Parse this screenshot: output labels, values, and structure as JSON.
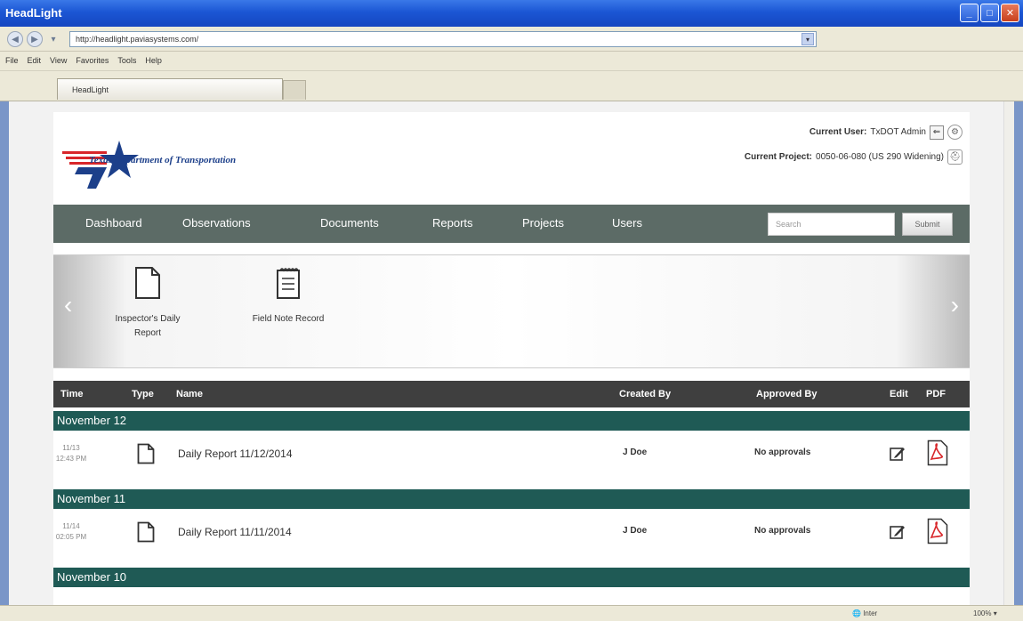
{
  "window": {
    "title": "HeadLight"
  },
  "browser": {
    "url": "http://headlight.paviasystems.com/",
    "menu": [
      "File",
      "Edit",
      "View",
      "Favorites",
      "Tools",
      "Help"
    ],
    "tab_title": "HeadLight",
    "status_zone": "Inter",
    "zoom": "100%"
  },
  "header": {
    "logo_text": "Texas Department of Transportation",
    "user_label": "Current User:",
    "user_value": "TxDOT Admin",
    "project_label": "Current Project:",
    "project_value": "0050-06-080 (US 290 Widening)"
  },
  "nav": {
    "items": [
      "Dashboard",
      "Observations",
      "Documents",
      "Reports",
      "Projects",
      "Users"
    ],
    "search_placeholder": "Search",
    "submit_label": "Submit"
  },
  "forms": [
    {
      "label": "Inspector's Daily Report",
      "icon": "document-icon"
    },
    {
      "label": "Field Note Record",
      "icon": "notepad-icon"
    }
  ],
  "table": {
    "headers": {
      "time": "Time",
      "type": "Type",
      "name": "Name",
      "created_by": "Created By",
      "approved_by": "Approved By",
      "edit": "Edit",
      "pdf": "PDF"
    },
    "groups": [
      {
        "date": "November 12",
        "rows": [
          {
            "time": "11/13 12:43 PM",
            "name": "Daily Report 11/12/2014",
            "created_by": "J Doe",
            "approved_by": "No approvals"
          }
        ]
      },
      {
        "date": "November 11",
        "rows": [
          {
            "time": "11/14 02:05 PM",
            "name": "Daily Report 11/11/2014",
            "created_by": "J Doe",
            "approved_by": "No approvals"
          }
        ]
      },
      {
        "date": "November 10",
        "rows": []
      }
    ]
  },
  "colors": {
    "navbar": "#5c6b66",
    "group_row": "#1f5a55",
    "table_head": "#3f3f3f",
    "brand_blue": "#1c3f8a",
    "brand_red": "#d8262a"
  }
}
